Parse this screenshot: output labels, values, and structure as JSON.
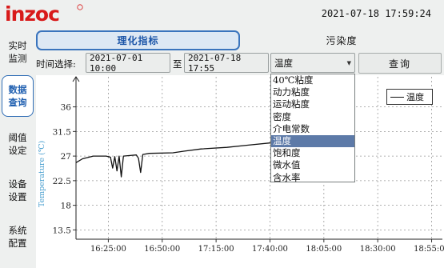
{
  "header": {
    "brand": "inzoc",
    "datetime": "2021-07-18  17:59:24"
  },
  "sidebar": {
    "items": [
      {
        "label_line1": "实时",
        "label_line2": "监测"
      },
      {
        "label_line1": "数据",
        "label_line2": "查询"
      },
      {
        "label_line1": "阈值",
        "label_line2": "设定"
      },
      {
        "label_line1": "设备",
        "label_line2": "设置"
      },
      {
        "label_line1": "系统",
        "label_line2": "配置"
      }
    ]
  },
  "tabs": [
    {
      "label": "理化指标"
    },
    {
      "label": "污染度"
    }
  ],
  "query": {
    "time_label": "时间选择:",
    "start": "2021-07-01 10:00",
    "sep": "至",
    "end": "2021-07-18 17:55",
    "selected_param": "温度",
    "button": "查询"
  },
  "dropdown": {
    "options": [
      "40℃粘度",
      "动力粘度",
      "运动粘度",
      "密度",
      "介电常数",
      "温度",
      "饱和度",
      "微水值",
      "含水率"
    ],
    "selected_index": 5
  },
  "chart_data": {
    "type": "line",
    "ylabel": "Temperature (℃)",
    "y_ticks": [
      13.5,
      18,
      22.5,
      27,
      31.5,
      36
    ],
    "ylim": [
      11.8,
      41.5
    ],
    "x_ticks": [
      "16:25:00",
      "16:50:00",
      "17:15:00",
      "17:40:00",
      "18:05:00",
      "18:30:00",
      "18:55:00"
    ],
    "xlim_minutes": [
      0,
      170
    ],
    "legend_position": "top-right",
    "series": [
      {
        "name": "温度",
        "points": [
          [
            0,
            25.8
          ],
          [
            3,
            26.5
          ],
          [
            8,
            27.0
          ],
          [
            14,
            27.0
          ],
          [
            16,
            26.8
          ],
          [
            17,
            24.8
          ],
          [
            18,
            26.9
          ],
          [
            19,
            24.3
          ],
          [
            20,
            27.0
          ],
          [
            21,
            23.2
          ],
          [
            22,
            27.0
          ],
          [
            25,
            27.1
          ],
          [
            28,
            27.2
          ],
          [
            29,
            26.6
          ],
          [
            30,
            24.0
          ],
          [
            31,
            27.3
          ],
          [
            34,
            27.5
          ],
          [
            45,
            27.6
          ],
          [
            50,
            27.9
          ],
          [
            58,
            28.3
          ],
          [
            70,
            28.6
          ],
          [
            80,
            29.0
          ],
          [
            90,
            29.4
          ],
          [
            97,
            29.6
          ],
          [
            100,
            29.7
          ],
          [
            104,
            29.8
          ]
        ]
      }
    ]
  },
  "colors": {
    "accent": "#3a74bd",
    "selected_option": "#5d7aa8",
    "series": "#111111"
  }
}
